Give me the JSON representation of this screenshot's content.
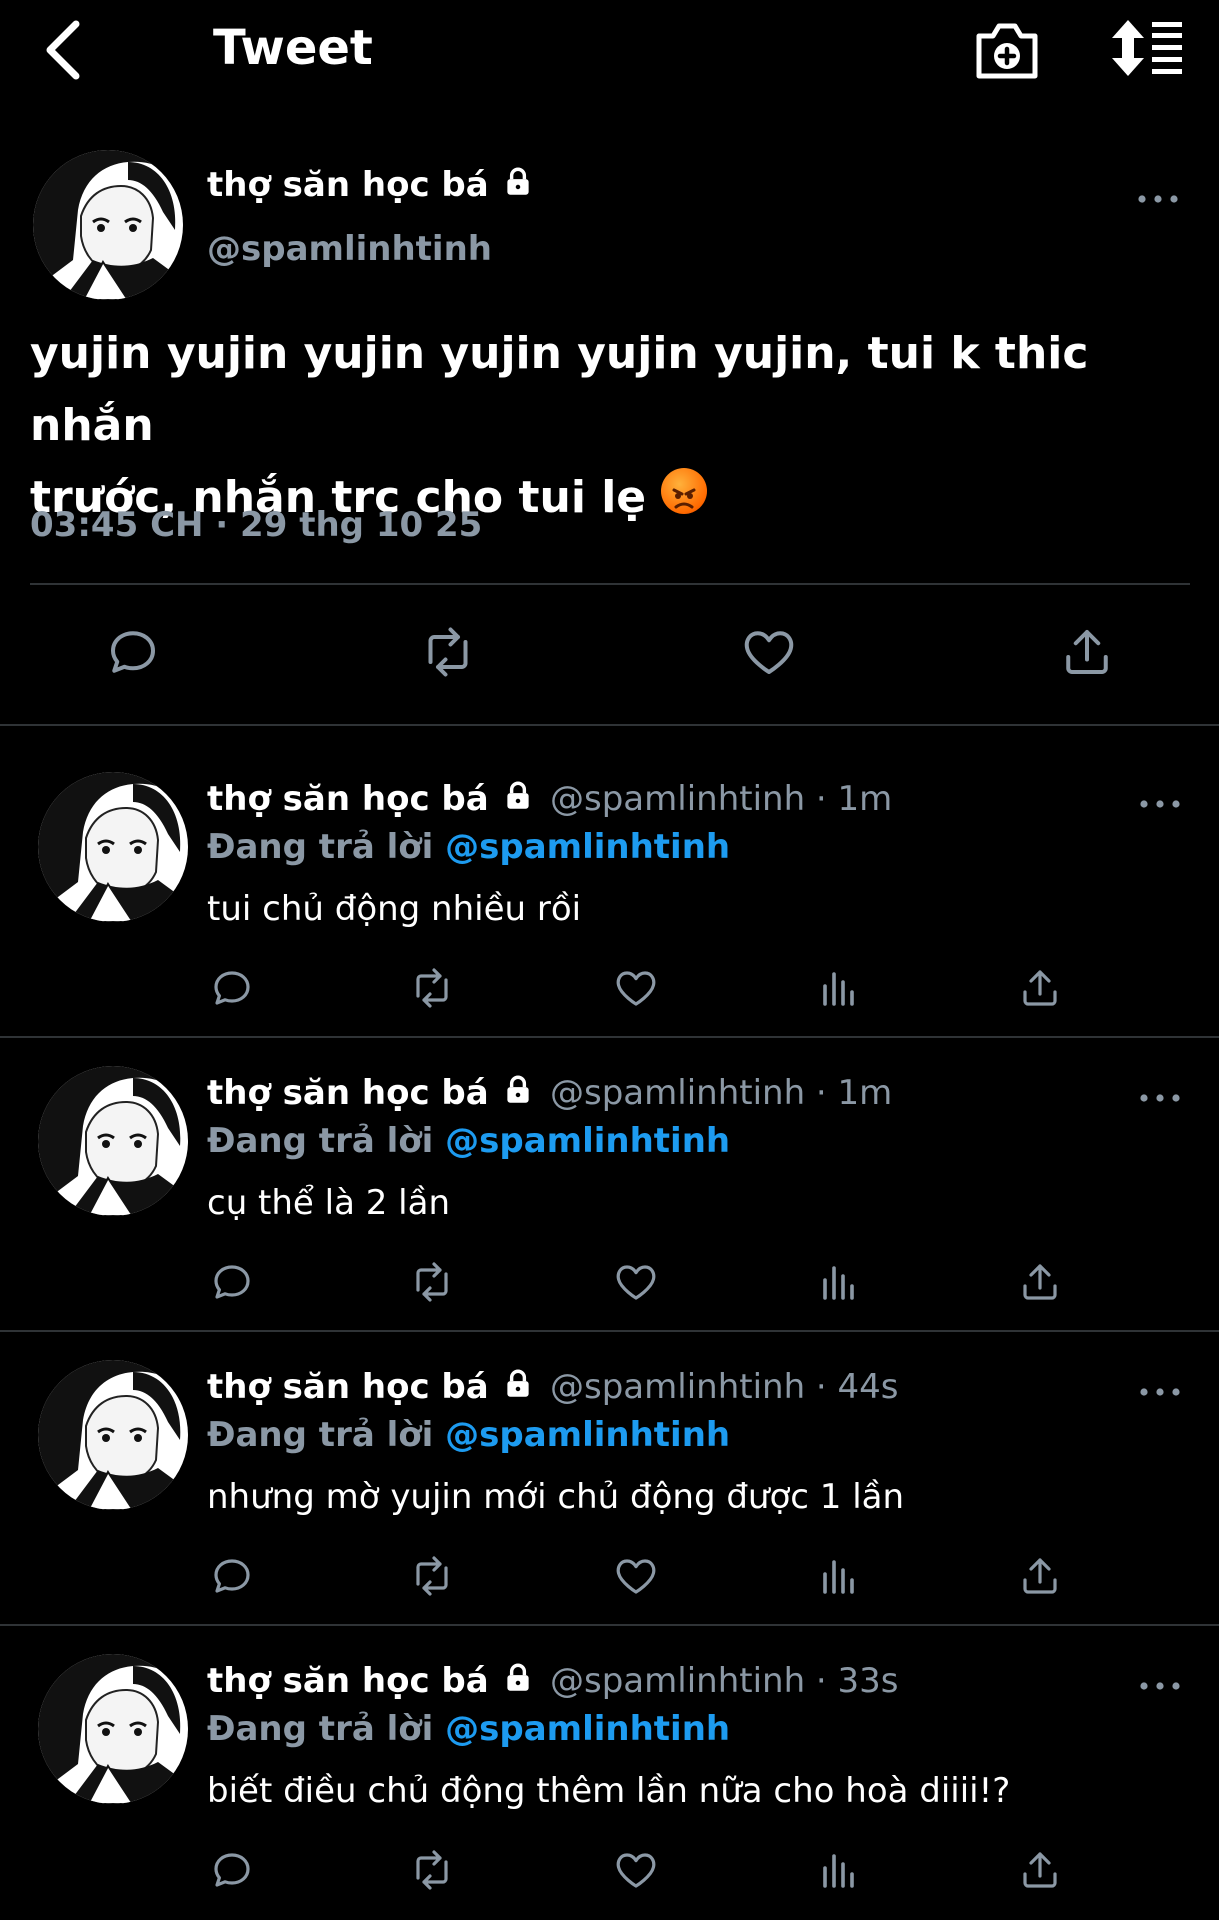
{
  "header": {
    "title": "Tweet"
  },
  "main_tweet": {
    "name": "thợ săn học bá",
    "handle": "@spamlinhtinh",
    "body": "yujin yujin yujin yujin yujin yujin, tui k thic nhắn\ntrước, nhắn trc cho tui lẹ",
    "emoji": "angry-face",
    "timestamp": "03:45 CH · 29 thg 10 25"
  },
  "replies": [
    {
      "name": "thợ săn học bá",
      "meta": "@spamlinhtinh · 1m",
      "replying_prefix": "Đang trả lời",
      "replying_to": "@spamlinhtinh",
      "text": "tui chủ động nhiều rồi"
    },
    {
      "name": "thợ săn học bá",
      "meta": "@spamlinhtinh · 1m",
      "replying_prefix": "Đang trả lời",
      "replying_to": "@spamlinhtinh",
      "text": "cụ thể là 2 lần"
    },
    {
      "name": "thợ săn học bá",
      "meta": "@spamlinhtinh · 44s",
      "replying_prefix": "Đang trả lời",
      "replying_to": "@spamlinhtinh",
      "text": "nhưng mờ yujin mới chủ động được 1 lần"
    },
    {
      "name": "thợ săn học bá",
      "meta": "@spamlinhtinh · 33s",
      "replying_prefix": "Đang trả lời",
      "replying_to": "@spamlinhtinh",
      "text": "biết điều chủ động thêm lần nữa cho hoà diiii!?"
    }
  ],
  "colors": {
    "background": "#000000",
    "secondary_text": "#8b98a5",
    "accent": "#1d9bf0",
    "divider": "#2f3336"
  }
}
